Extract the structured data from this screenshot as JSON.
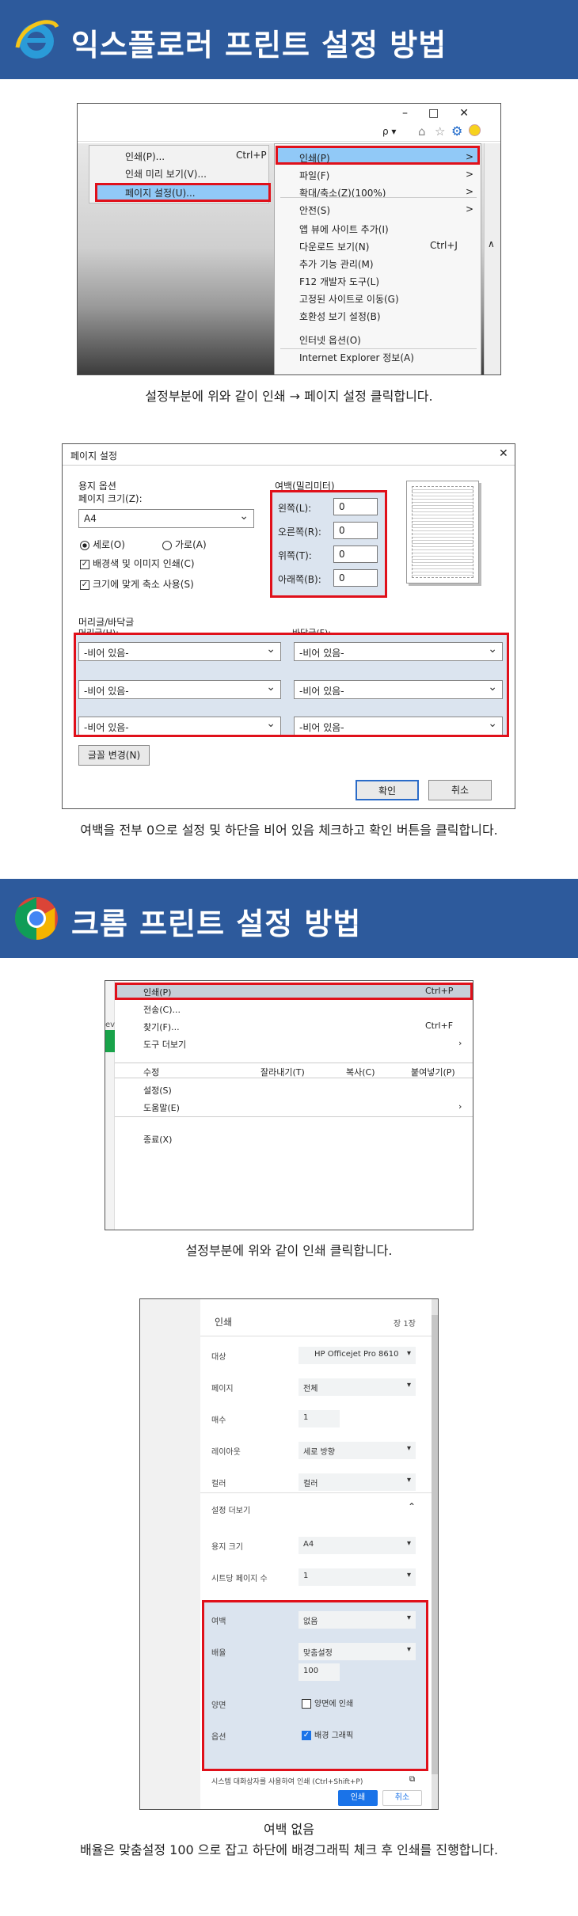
{
  "ie_section": {
    "title": "익스플로러 프린트 설정 방법",
    "screenshot1": {
      "left_menu": [
        "인쇄(P)...",
        "인쇄 미리 보기(V)...",
        "페이지 설정(U)..."
      ],
      "left_shortcut": "Ctrl+P",
      "tools_menu": [
        {
          "label": "인쇄(P)",
          "shortcut": ">"
        },
        {
          "label": "파일(F)",
          "shortcut": ">"
        },
        {
          "label": "확대/축소(Z)(100%)",
          "shortcut": ">"
        },
        {
          "label": "안전(S)",
          "shortcut": ">"
        },
        {
          "label": "앱 뷰에 사이트 추가(I)",
          "shortcut": ""
        },
        {
          "label": "다운로드 보기(N)",
          "shortcut": "Ctrl+J"
        },
        {
          "label": "추가 기능 관리(M)",
          "shortcut": ""
        },
        {
          "label": "F12 개발자 도구(L)",
          "shortcut": ""
        },
        {
          "label": "고정된 사이트로 이동(G)",
          "shortcut": ""
        },
        {
          "label": "호환성 보기 설정(B)",
          "shortcut": ""
        },
        {
          "label": "인터넷 옵션(O)",
          "shortcut": ""
        },
        {
          "label": "Internet Explorer 정보(A)",
          "shortcut": ""
        }
      ],
      "search_glyph": "ρ ▾"
    },
    "caption1": "설정부분에 위와 같이 인쇄 → 페이지 설정 클릭합니다.",
    "dialog": {
      "title": "페이지 설정",
      "paper_group": "용지 옵션",
      "page_size_label": "페이지 크기(Z):",
      "page_size": "A4",
      "portrait": "세로(O)",
      "landscape": "가로(A)",
      "bg_print": "배경색 및 이미지 인쇄(C)",
      "shrink": "크기에 맞게 축소 사용(S)",
      "margin_group": "여백(밀리미터)",
      "margins": [
        {
          "label": "왼쪽(L):",
          "value": "0"
        },
        {
          "label": "오른쪽(R):",
          "value": "0"
        },
        {
          "label": "위쪽(T):",
          "value": "0"
        },
        {
          "label": "아래쪽(B):",
          "value": "0"
        }
      ],
      "hf_group": "머리글/바닥글",
      "header_label": "머리글(H):",
      "footer_label": "바닥글(F):",
      "empty_option": "-비어 있음-",
      "font_button": "글꼴 변경(N)",
      "ok": "확인",
      "cancel": "취소"
    },
    "caption2": "여백을 전부 0으로 설정 및 하단을 비어 있음 체크하고 확인 버튼을 클릭합니다."
  },
  "chrome_section": {
    "title": "크롬 프린트 설정 방법",
    "menu": {
      "items": [
        {
          "label": "인쇄(P)",
          "shortcut": "Ctrl+P"
        },
        {
          "label": "전송(C)...",
          "shortcut": ""
        },
        {
          "label": "찾기(F)...",
          "shortcut": "Ctrl+F"
        },
        {
          "label": "도구 더보기",
          "shortcut": "›"
        }
      ],
      "edit_row": [
        "수정",
        "잘라내기(T)",
        "복사(C)",
        "붙여넣기(P)"
      ],
      "items2": [
        {
          "label": "설정(S)",
          "shortcut": ""
        },
        {
          "label": "도움말(E)",
          "shortcut": "›"
        }
      ],
      "exit": "종료(X)",
      "side_text": "ev"
    },
    "caption3": "설정부분에 위와 같이 인쇄 클릭합니다.",
    "print": {
      "title": "인쇄",
      "pages_count": "장 1장",
      "rows": [
        {
          "label": "대상",
          "value": "HP Officejet Pro 8610"
        },
        {
          "label": "페이지",
          "value": "전체"
        },
        {
          "label": "매수",
          "value": "1"
        },
        {
          "label": "레이아웃",
          "value": "세로 방향"
        },
        {
          "label": "컬러",
          "value": "컬러"
        }
      ],
      "more_settings": "설정 더보기",
      "rows2": [
        {
          "label": "용지 크기",
          "value": "A4"
        },
        {
          "label": "시트당 페이지 수",
          "value": "1"
        }
      ],
      "margin_label": "여백",
      "margin_value": "없음",
      "scale_label": "배율",
      "scale_value": "맞춤설정",
      "scale_number": "100",
      "duplex_label": "양면",
      "duplex_option": "양면에 인쇄",
      "options_label": "옵션",
      "bg_graphics": "배경 그래픽",
      "system_dialog": "시스템 대화상자를 사용하여 인쇄 (Ctrl+Shift+P)",
      "print_button": "인쇄",
      "cancel_button": "취소"
    },
    "caption4_line1": "여백 없음",
    "caption4_line2": "배율은 맞춤설정 100 으로 잡고 하단에 배경그래픽 체크 후 인쇄를 진행합니다."
  },
  "colors": {
    "banner": "#2d5a9c",
    "highlight": "#e0101a",
    "menu_select": "#91c9f7"
  }
}
